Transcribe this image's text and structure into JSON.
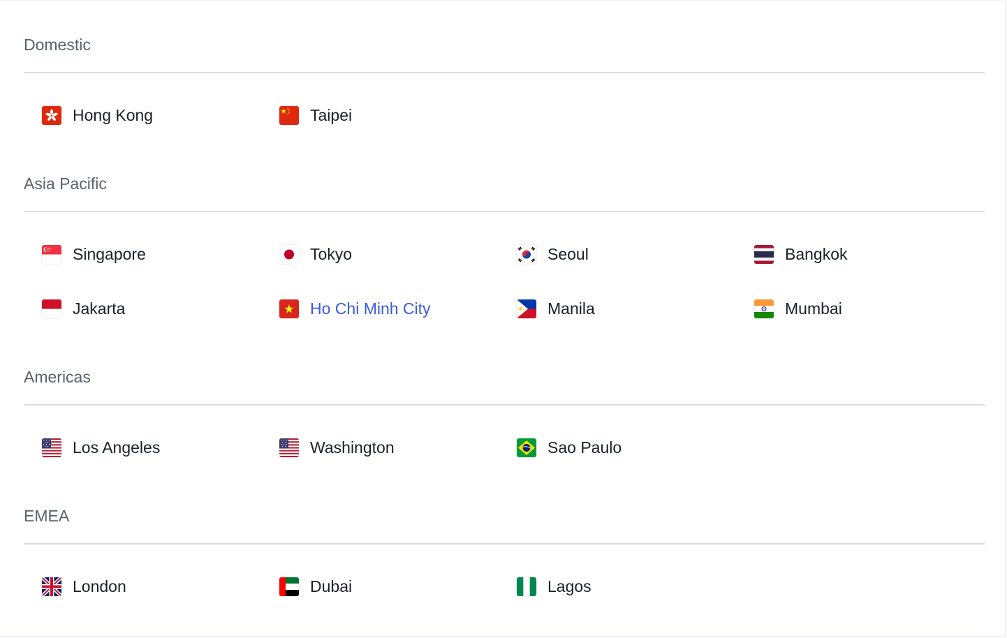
{
  "sections": [
    {
      "title": "Domestic",
      "cities": [
        {
          "label": "Hong Kong",
          "flag": "hong-kong-flag-icon"
        },
        {
          "label": "Taipei",
          "flag": "china-flag-icon"
        }
      ]
    },
    {
      "title": "Asia Pacific",
      "cities": [
        {
          "label": "Singapore",
          "flag": "singapore-flag-icon"
        },
        {
          "label": "Tokyo",
          "flag": "japan-flag-icon"
        },
        {
          "label": "Seoul",
          "flag": "south-korea-flag-icon"
        },
        {
          "label": "Bangkok",
          "flag": "thailand-flag-icon"
        },
        {
          "label": "Jakarta",
          "flag": "indonesia-flag-icon"
        },
        {
          "label": "Ho Chi Minh City",
          "flag": "vietnam-flag-icon",
          "active": true
        },
        {
          "label": "Manila",
          "flag": "philippines-flag-icon"
        },
        {
          "label": "Mumbai",
          "flag": "india-flag-icon"
        }
      ]
    },
    {
      "title": "Americas",
      "cities": [
        {
          "label": "Los Angeles",
          "flag": "usa-flag-icon"
        },
        {
          "label": "Washington",
          "flag": "usa-flag-icon"
        },
        {
          "label": "Sao Paulo",
          "flag": "brazil-flag-icon"
        }
      ]
    },
    {
      "title": "EMEA",
      "cities": [
        {
          "label": "London",
          "flag": "uk-flag-icon"
        },
        {
          "label": "Dubai",
          "flag": "uae-flag-icon"
        },
        {
          "label": "Lagos",
          "flag": "nigeria-flag-icon"
        }
      ]
    }
  ],
  "colors": {
    "section_title": "#5a6170",
    "divider": "#d8dbe6",
    "text": "#1b1f2a",
    "active": "#3b5bdb"
  }
}
